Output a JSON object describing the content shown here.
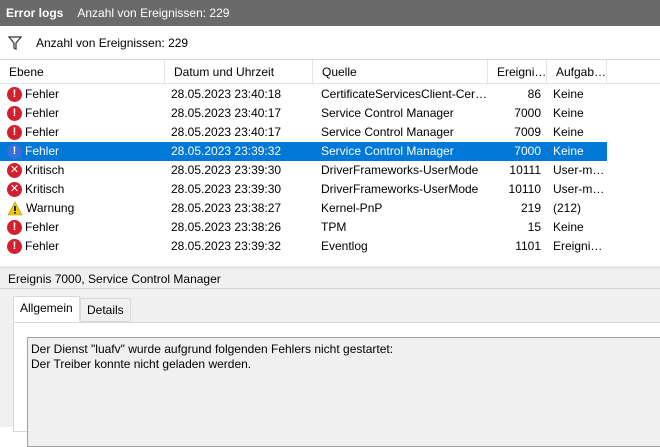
{
  "titlebar": {
    "title": "Error logs",
    "subtitle": "Anzahl von Ereignissen: 229"
  },
  "filter": {
    "icon": "filter-icon",
    "text": "Anzahl von Ereignissen: 229"
  },
  "columns": [
    "Ebene",
    "Datum und Uhrzeit",
    "Quelle",
    "Ereigni…",
    "Aufgab…"
  ],
  "rows": [
    {
      "level": "Fehler",
      "icon": "error-icon",
      "datetime": "28.05.2023 23:40:18",
      "source": "CertificateServicesClient-Cer…",
      "id": "86",
      "task": "Keine",
      "selected": false
    },
    {
      "level": "Fehler",
      "icon": "error-icon",
      "datetime": "28.05.2023 23:40:17",
      "source": "Service Control Manager",
      "id": "7000",
      "task": "Keine",
      "selected": false
    },
    {
      "level": "Fehler",
      "icon": "error-icon",
      "datetime": "28.05.2023 23:40:17",
      "source": "Service Control Manager",
      "id": "7009",
      "task": "Keine",
      "selected": false
    },
    {
      "level": "Fehler",
      "icon": "error-icon",
      "datetime": "28.05.2023 23:39:32",
      "source": "Service Control Manager",
      "id": "7000",
      "task": "Keine",
      "selected": true
    },
    {
      "level": "Kritisch",
      "icon": "critical-icon",
      "datetime": "28.05.2023 23:39:30",
      "source": "DriverFrameworks-UserMode",
      "id": "10111",
      "task": "User-m…",
      "selected": false
    },
    {
      "level": "Kritisch",
      "icon": "critical-icon",
      "datetime": "28.05.2023 23:39:30",
      "source": "DriverFrameworks-UserMode",
      "id": "10110",
      "task": "User-m…",
      "selected": false
    },
    {
      "level": "Warnung",
      "icon": "warning-icon",
      "datetime": "28.05.2023 23:38:27",
      "source": "Kernel-PnP",
      "id": "219",
      "task": "(212)",
      "selected": false
    },
    {
      "level": "Fehler",
      "icon": "error-icon",
      "datetime": "28.05.2023 23:38:26",
      "source": "TPM",
      "id": "15",
      "task": "Keine",
      "selected": false
    },
    {
      "level": "Fehler",
      "icon": "error-icon",
      "datetime": "28.05.2023 23:39:32",
      "source": "Eventlog",
      "id": "1101",
      "task": "Ereigni…",
      "selected": false
    }
  ],
  "detail": {
    "header": "Ereignis 7000, Service Control Manager",
    "tabs": [
      "Allgemein",
      "Details"
    ],
    "message_line1": "Der Dienst \"luafv\" wurde aufgrund folgenden Fehlers nicht gestartet:",
    "message_line2": "Der Treiber konnte nicht geladen werden."
  },
  "colors": {
    "selection": "#0078d7",
    "error": "#d3202e",
    "warning": "#f2c80f",
    "titlebar": "#6a6a6a"
  }
}
